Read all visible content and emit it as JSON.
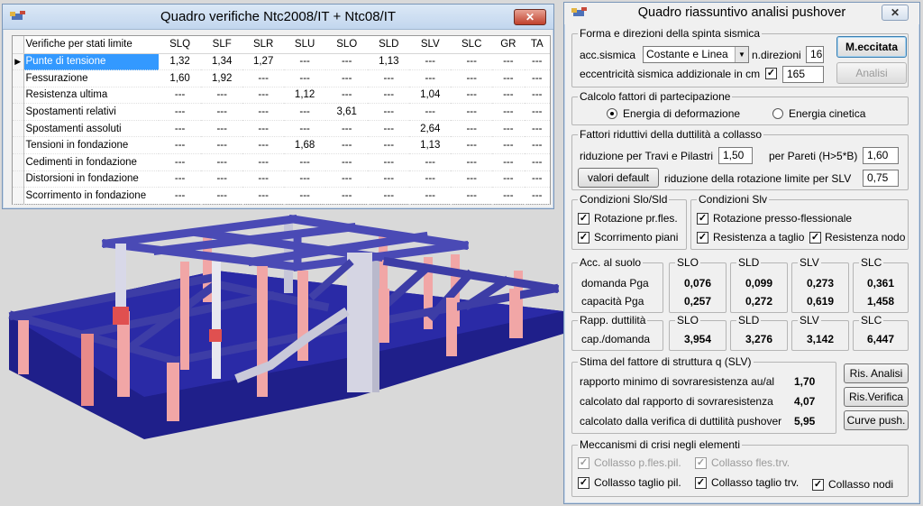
{
  "verifiche": {
    "title": "Quadro verifiche Ntc2008/IT + Ntc08/IT",
    "close": "✕",
    "headers": [
      "Verifiche per stati limite",
      "SLQ",
      "SLF",
      "SLR",
      "SLU",
      "SLO",
      "SLD",
      "SLV",
      "SLC",
      "GR",
      "TA"
    ],
    "rows": [
      [
        "Punte di tensione",
        "1,32",
        "1,34",
        "1,27",
        "---",
        "---",
        "1,13",
        "---",
        "---",
        "---",
        "---"
      ],
      [
        "Fessurazione",
        "1,60",
        "1,92",
        "---",
        "---",
        "---",
        "---",
        "---",
        "---",
        "---",
        "---"
      ],
      [
        "Resistenza ultima",
        "---",
        "---",
        "---",
        "1,12",
        "---",
        "---",
        "1,04",
        "---",
        "---",
        "---"
      ],
      [
        "Spostamenti relativi",
        "---",
        "---",
        "---",
        "---",
        "3,61",
        "---",
        "---",
        "---",
        "---",
        "---"
      ],
      [
        "Spostamenti assoluti",
        "---",
        "---",
        "---",
        "---",
        "---",
        "---",
        "2,64",
        "---",
        "---",
        "---"
      ],
      [
        "Tensioni in fondazione",
        "---",
        "---",
        "---",
        "1,68",
        "---",
        "---",
        "1,13",
        "---",
        "---",
        "---"
      ],
      [
        "Cedimenti in fondazione",
        "---",
        "---",
        "---",
        "---",
        "---",
        "---",
        "---",
        "---",
        "---",
        "---"
      ],
      [
        "Distorsioni in fondazione",
        "---",
        "---",
        "---",
        "---",
        "---",
        "---",
        "---",
        "---",
        "---",
        "---"
      ],
      [
        "Scorrimento in fondazione",
        "---",
        "---",
        "---",
        "---",
        "---",
        "---",
        "---",
        "---",
        "---",
        "---"
      ]
    ]
  },
  "pushover": {
    "title": "Quadro riassuntivo analisi pushover",
    "close": "✕",
    "forma": {
      "legend": "Forma e direzioni della spinta sismica",
      "acc_label": "acc.sismica",
      "acc_value": "Costante e Linea",
      "ndir_label": "n.direzioni",
      "ndir_value": "16",
      "ecc_label": "eccentricità sismica addizionale in cm",
      "ecc_value": "165",
      "btn_meccitata": "M.eccitata",
      "btn_analisi": "Analisi"
    },
    "partecipazione": {
      "legend": "Calcolo fattori di partecipazione",
      "opt1": "Energia di deformazione",
      "opt2": "Energia cinetica"
    },
    "fattori": {
      "legend": "Fattori riduttivi della duttilità a collasso",
      "travi_label": "riduzione per Travi e Pilastri",
      "travi_value": "1,50",
      "pareti_label": "per Pareti (H>5*B)",
      "pareti_value": "1,60",
      "btn_default": "valori default",
      "rot_label": "riduzione della rotazione limite per SLV",
      "rot_value": "0,75"
    },
    "slo_sld": {
      "legend": "Condizioni Slo/Sld",
      "chk1": "Rotazione pr.fles.",
      "chk2": "Scorrimento piani"
    },
    "slv": {
      "legend": "Condizioni Slv",
      "chk1": "Rotazione presso-flessionale",
      "chk2": "Resistenza a taglio",
      "chk3": "Resistenza nodo"
    },
    "acc": {
      "legend": "Acc. al suolo",
      "row1": "domanda Pga",
      "row2": "capacità Pga",
      "cols": [
        {
          "label": "SLO",
          "domanda": "0,076",
          "capacita": "0,257"
        },
        {
          "label": "SLD",
          "domanda": "0,099",
          "capacita": "0,272"
        },
        {
          "label": "SLV",
          "domanda": "0,273",
          "capacita": "0,619"
        },
        {
          "label": "SLC",
          "domanda": "0,361",
          "capacita": "1,458"
        }
      ]
    },
    "duttilita": {
      "legend": "Rapp. duttilità",
      "row": "cap./domanda",
      "cols": [
        {
          "label": "SLO",
          "value": "3,954"
        },
        {
          "label": "SLD",
          "value": "3,276"
        },
        {
          "label": "SLV",
          "value": "3,142"
        },
        {
          "label": "SLC",
          "value": "6,447"
        }
      ]
    },
    "stima": {
      "legend": "Stima del fattore di struttura q (SLV)",
      "r1": "rapporto minimo di sovraresistenza au/al",
      "v1": "1,70",
      "r2": "calcolato dal rapporto di sovraresistenza",
      "v2": "4,07",
      "r3": "calcolato dalla verifica di duttilità pushover",
      "v3": "5,95",
      "btn1": "Ris. Analisi",
      "btn2": "Ris.Verifica",
      "btn3": "Curve push."
    },
    "meccanismi": {
      "legend": "Meccanismi di crisi negli elementi",
      "c1": "Collasso p.fles.pil.",
      "c2": "Collasso fles.trv.",
      "c3": "Collasso taglio pil.",
      "c4": "Collasso taglio trv.",
      "c5": "Collasso nodi"
    }
  }
}
